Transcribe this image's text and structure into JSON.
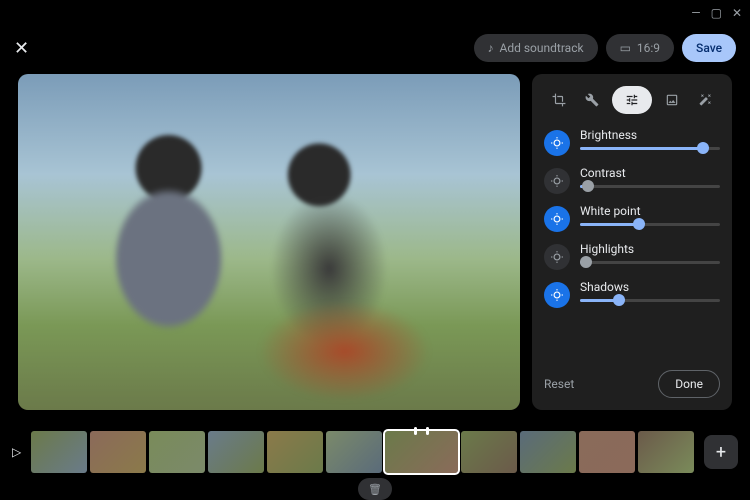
{
  "window": {
    "minimize": "—",
    "maximize": "▢",
    "close": "✕"
  },
  "topbar": {
    "close": "✕",
    "soundtrack_label": "Add soundtrack",
    "aspect_label": "16:9",
    "save_label": "Save"
  },
  "tools": {
    "crop": "crop",
    "suggestions": "tools",
    "adjust": "adjust",
    "filters": "filters",
    "markup": "magic",
    "active": "adjust"
  },
  "adjust": {
    "sliders": [
      {
        "key": "brightness",
        "label": "Brightness",
        "value": 88,
        "active": true
      },
      {
        "key": "contrast",
        "label": "Contrast",
        "value": 6,
        "active": false
      },
      {
        "key": "whitepoint",
        "label": "White point",
        "value": 42,
        "active": true
      },
      {
        "key": "highlights",
        "label": "Highlights",
        "value": 4,
        "active": false
      },
      {
        "key": "shadows",
        "label": "Shadows",
        "value": 28,
        "active": true
      }
    ],
    "reset_label": "Reset",
    "done_label": "Done"
  },
  "timeline": {
    "play": "▷",
    "clip_count": 11,
    "selected_index": 6,
    "add": "+",
    "delete": "🗑"
  }
}
